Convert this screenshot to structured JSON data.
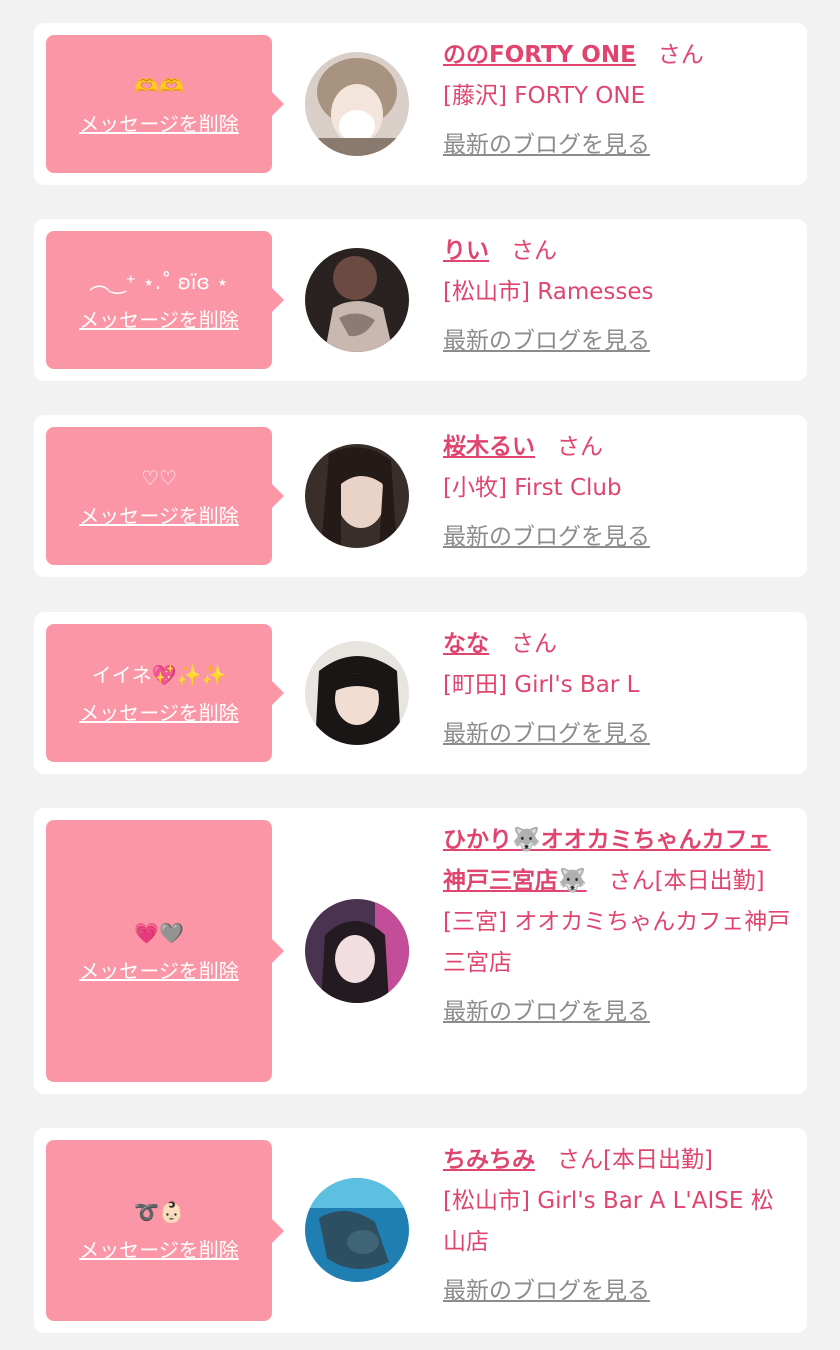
{
  "colors": {
    "accent": "#e0456f",
    "bubble": "#fb96a6",
    "link_gray": "#8c8c8c",
    "background": "#f2f2f2"
  },
  "items": [
    {
      "message": "🫶🫶",
      "delete_label": "メッセージを削除",
      "name": "ののFORTY ONE",
      "suffix": "さん",
      "status": "",
      "shop": "[藤沢] FORTY ONE",
      "blog_label": "最新のブログを見る"
    },
    {
      "message": "︵‿⁺ ⋆.˚ ʚïɞ ⋆",
      "delete_label": "メッセージを削除",
      "name": "りい",
      "suffix": "さん",
      "status": "",
      "shop": "[松山市] Ramesses",
      "blog_label": "最新のブログを見る"
    },
    {
      "message": "♡♡",
      "delete_label": "メッセージを削除",
      "name": "桜木るい",
      "suffix": "さん",
      "status": "",
      "shop": "[小牧] First Club",
      "blog_label": "最新のブログを見る"
    },
    {
      "message": "イイネ💖✨✨",
      "delete_label": "メッセージを削除",
      "name": "なな",
      "suffix": "さん",
      "status": "",
      "shop": "[町田] Girl's Bar L",
      "blog_label": "最新のブログを見る"
    },
    {
      "message": "💗🩶",
      "delete_label": "メッセージを削除",
      "name": "ひかり🐺オオカミちゃんカフェ神戸三宮店🐺",
      "suffix": "さん",
      "status": "[本日出勤]",
      "shop": "[三宮] オオカミちゃんカフェ神戸三宮店",
      "blog_label": "最新のブログを見る"
    },
    {
      "message": "➰👶🏻",
      "delete_label": "メッセージを削除",
      "name": "ちみちみ",
      "suffix": "さん",
      "status": "[本日出勤]",
      "shop": "[松山市] Girl's Bar A L'AISE 松山店",
      "blog_label": "最新のブログを見る"
    }
  ]
}
